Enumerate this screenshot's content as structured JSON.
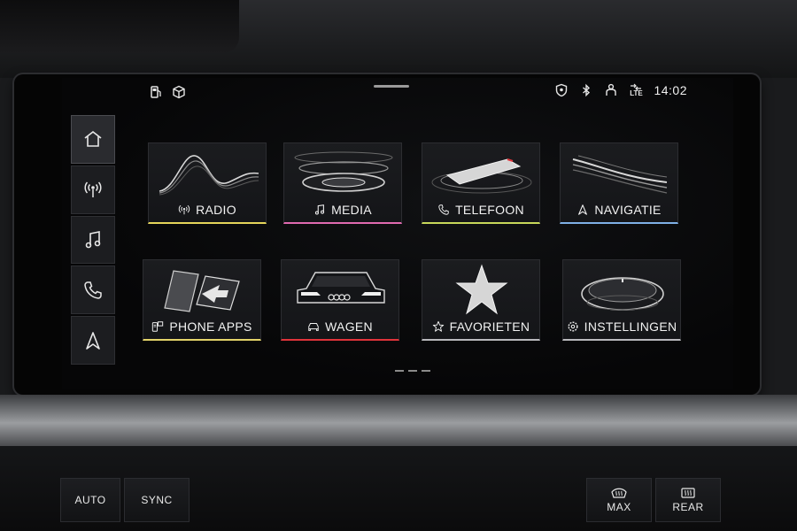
{
  "status": {
    "left_icons": [
      "fuel-pump-icon",
      "package-cube-icon"
    ],
    "right_icons": [
      "shield-location-icon",
      "bluetooth-icon",
      "person-icon",
      "lte-signal-icon"
    ],
    "network": "LTE",
    "time": "14:02"
  },
  "nav": {
    "items": [
      {
        "icon": "home-icon",
        "active": true
      },
      {
        "icon": "radio-antenna-icon",
        "active": false
      },
      {
        "icon": "music-note-icon",
        "active": false
      },
      {
        "icon": "phone-icon",
        "active": false
      },
      {
        "icon": "navigation-arrow-icon",
        "active": false
      }
    ]
  },
  "tiles": [
    {
      "label": "RADIO",
      "icon": "radio-antenna-icon",
      "accent": "#e5d55a"
    },
    {
      "label": "MEDIA",
      "icon": "music-note-icon",
      "accent": "#e06ab0"
    },
    {
      "label": "TELEFOON",
      "icon": "phone-icon",
      "accent": "#c8d85a"
    },
    {
      "label": "NAVIGATIE",
      "icon": "navigation-arrow-icon",
      "accent": "#7fb0e6"
    },
    {
      "label": "PHONE APPS",
      "icon": "phone-apps-icon",
      "accent": "#e3d36a"
    },
    {
      "label": "WAGEN",
      "icon": "car-icon",
      "accent": "#e0343a"
    },
    {
      "label": "FAVORIETEN",
      "icon": "star-icon",
      "accent": "#b9b9bd"
    },
    {
      "label": "INSTELLINGEN",
      "icon": "gear-icon",
      "accent": "#b9b9bd"
    }
  ],
  "pager": {
    "pages": 3
  },
  "console": {
    "auto_label": "AUTO",
    "sync_label": "SYNC",
    "max_label": "MAX",
    "rear_label": "REAR"
  }
}
